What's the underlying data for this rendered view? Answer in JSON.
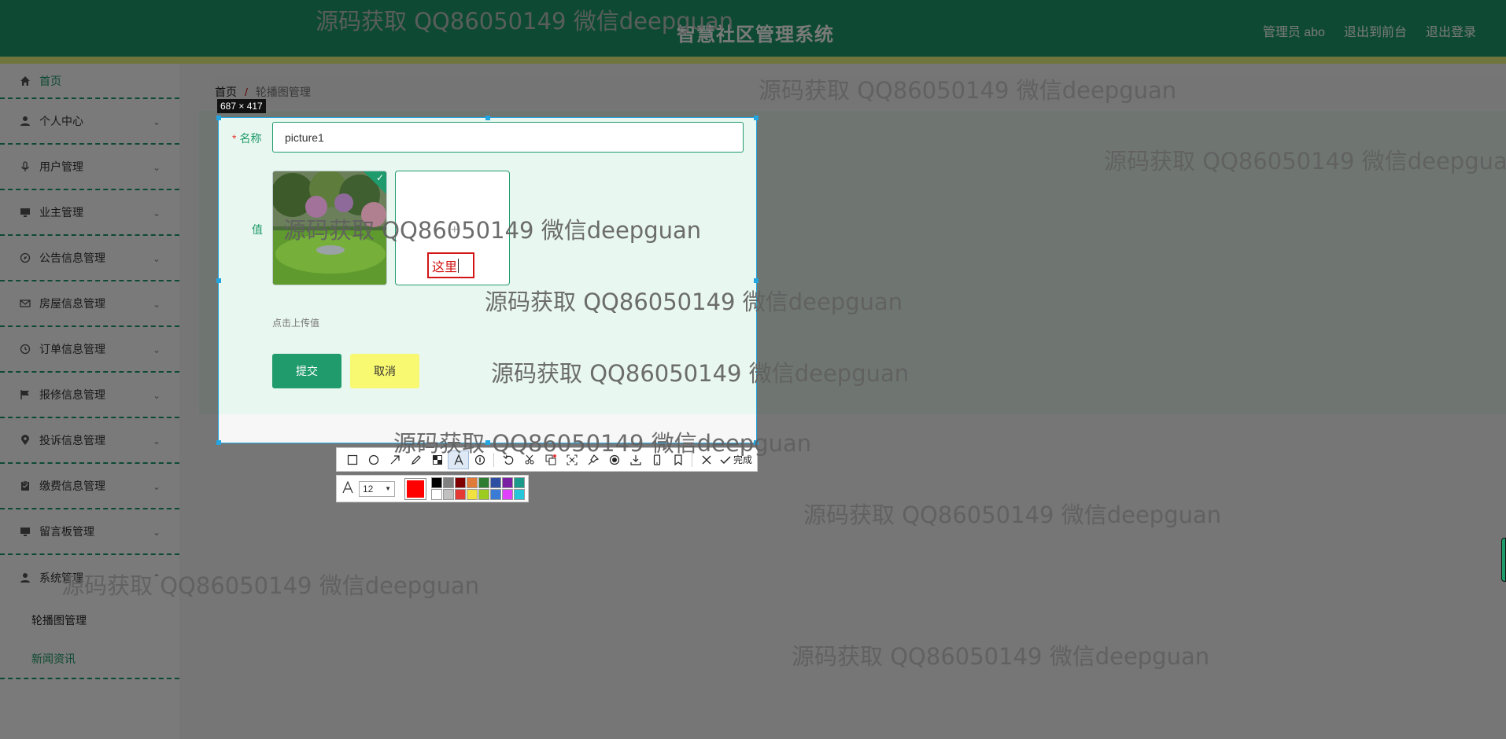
{
  "header": {
    "title": "智慧社区管理系统",
    "admin_label": "管理员 abo",
    "back_front_label": "退出到前台",
    "logout_label": "退出登录"
  },
  "sidebar": {
    "items": [
      {
        "label": "首页",
        "icon": "home-icon"
      },
      {
        "label": "个人中心",
        "icon": "person-icon"
      },
      {
        "label": "用户管理",
        "icon": "microphone-icon"
      },
      {
        "label": "业主管理",
        "icon": "monitor-icon"
      },
      {
        "label": "公告信息管理",
        "icon": "compass-icon"
      },
      {
        "label": "房屋信息管理",
        "icon": "mail-icon"
      },
      {
        "label": "订单信息管理",
        "icon": "clock-icon"
      },
      {
        "label": "报修信息管理",
        "icon": "flag-icon"
      },
      {
        "label": "投诉信息管理",
        "icon": "location-icon"
      },
      {
        "label": "缴费信息管理",
        "icon": "clipboard-icon"
      },
      {
        "label": "留言板管理",
        "icon": "monitor-icon"
      },
      {
        "label": "系统管理",
        "icon": "person-icon"
      }
    ],
    "sub_items": [
      "轮播图管理",
      "新闻资讯"
    ]
  },
  "breadcrumb": {
    "home": "首页",
    "separator": "/",
    "current": "轮播图管理"
  },
  "capture": {
    "size_label": "687 × 417"
  },
  "form": {
    "name_label": "名称",
    "name_required_mark": "*",
    "name_value": "picture1",
    "value_label": "值",
    "annotation_text": "这里",
    "upload_hint": "点击上传值",
    "submit_label": "提交",
    "cancel_label": "取消"
  },
  "toolbar": {
    "done_label": "完成",
    "font_size": "12",
    "current_color": "#ff0000",
    "palette": [
      "#000000",
      "#808080",
      "#800000",
      "#e07b39",
      "#2e7d32",
      "#2f4fa3",
      "#7b1fa2",
      "#1b998b",
      "#ffffff",
      "#c0c0c0",
      "#e53935",
      "#f1e23f",
      "#9ccc1f",
      "#3a7bd5",
      "#e040fb",
      "#26c6da"
    ]
  },
  "watermarks": [
    "源码获取 QQ86050149 微信deepguan",
    "源码获取 QQ86050149 微信deepguan",
    "源码获取 QQ86050149 微信deepguan",
    "源码获取 QQ86050149 微信deepguan",
    "源码获取 QQ86050149 微信deepguan",
    "源码获取 QQ86050149 微信deepguan",
    "源码获取 QQ86050149 微信deepguan",
    "源码获取 QQ86050149 微信deepguan",
    "源码获取 QQ86050149 微信deepguan",
    "源码获取 QQ86050149 微信deepguan"
  ],
  "colors": {
    "brand_green": "#1f9b6c",
    "accent_yellow": "#f9f871",
    "selection_blue": "#22a5e0"
  }
}
